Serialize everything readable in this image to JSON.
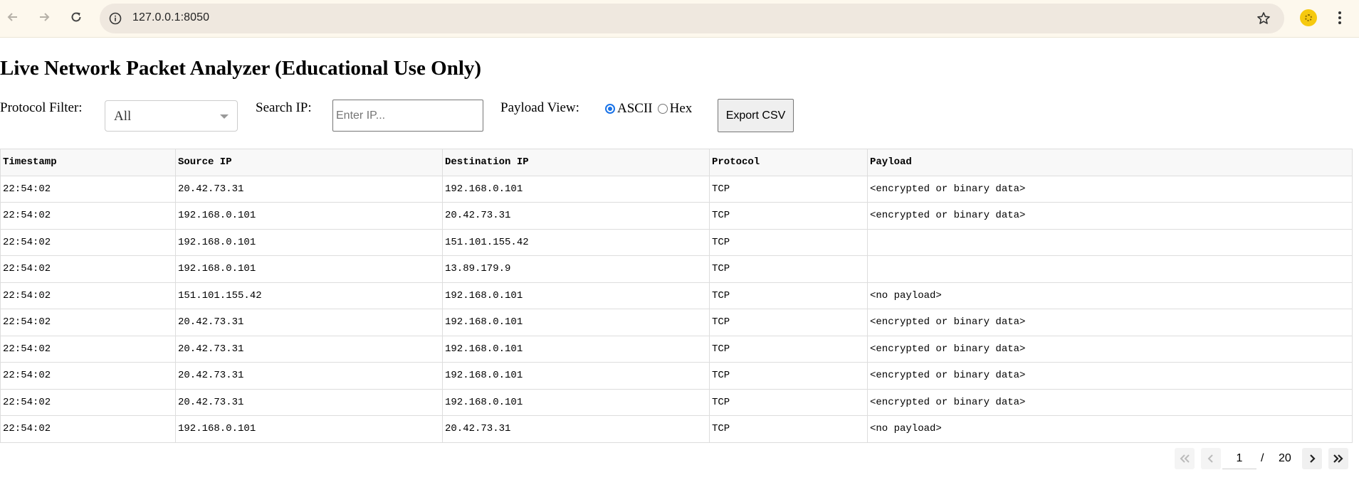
{
  "browser": {
    "url": "127.0.0.1:8050"
  },
  "page": {
    "title": "Live Network Packet Analyzer (Educational Use Only)"
  },
  "controls": {
    "protocol_filter_label": "Protocol Filter:",
    "protocol_filter_value": "All",
    "search_ip_label": "Search IP:",
    "search_ip_placeholder": "Enter IP...",
    "search_ip_value": "",
    "payload_view_label": "Payload View:",
    "payload_options": [
      {
        "label": "ASCII",
        "selected": true
      },
      {
        "label": "Hex",
        "selected": false
      }
    ],
    "export_label": "Export CSV"
  },
  "table": {
    "headers": [
      "Timestamp",
      "Source IP",
      "Destination IP",
      "Protocol",
      "Payload"
    ],
    "rows": [
      [
        "22:54:02",
        "20.42.73.31",
        "192.168.0.101",
        "TCP",
        "<encrypted or binary data>"
      ],
      [
        "22:54:02",
        "192.168.0.101",
        "20.42.73.31",
        "TCP",
        "<encrypted or binary data>"
      ],
      [
        "22:54:02",
        "192.168.0.101",
        "151.101.155.42",
        "TCP",
        ""
      ],
      [
        "22:54:02",
        "192.168.0.101",
        "13.89.179.9",
        "TCP",
        ""
      ],
      [
        "22:54:02",
        "151.101.155.42",
        "192.168.0.101",
        "TCP",
        "<no payload>"
      ],
      [
        "22:54:02",
        "20.42.73.31",
        "192.168.0.101",
        "TCP",
        "<encrypted or binary data>"
      ],
      [
        "22:54:02",
        "20.42.73.31",
        "192.168.0.101",
        "TCP",
        "<encrypted or binary data>"
      ],
      [
        "22:54:02",
        "20.42.73.31",
        "192.168.0.101",
        "TCP",
        "<encrypted or binary data>"
      ],
      [
        "22:54:02",
        "20.42.73.31",
        "192.168.0.101",
        "TCP",
        "<encrypted or binary data>"
      ],
      [
        "22:54:02",
        "192.168.0.101",
        "20.42.73.31",
        "TCP",
        "<no payload>"
      ]
    ]
  },
  "pagination": {
    "current_page": "1",
    "separator": "/",
    "total_pages": "20"
  }
}
